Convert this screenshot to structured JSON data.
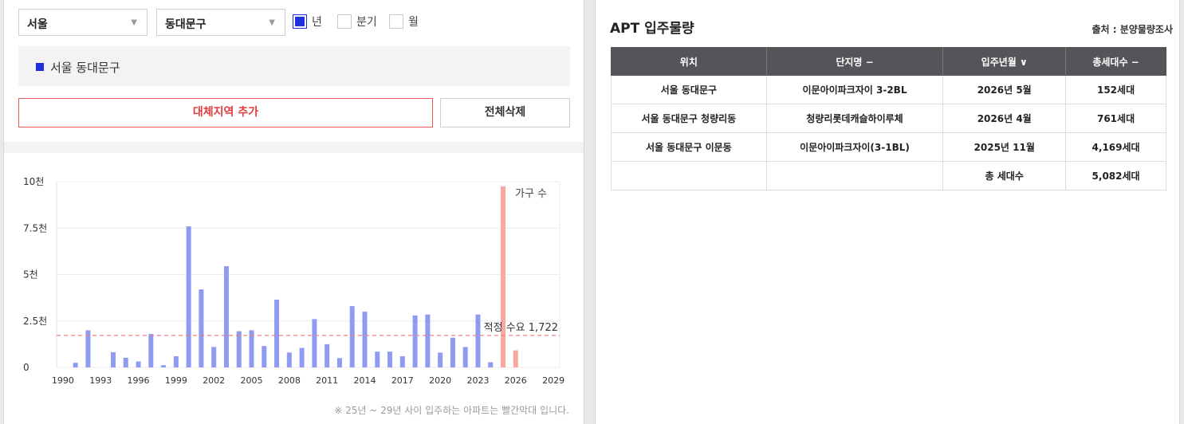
{
  "filters": {
    "sido": "서울",
    "gu": "동대문구",
    "period_options": [
      {
        "label": "년",
        "checked": true
      },
      {
        "label": "분기",
        "checked": false
      },
      {
        "label": "월",
        "checked": false
      }
    ]
  },
  "selected_region": "서울 동대문구",
  "buttons": {
    "add_region": "대체지역 추가",
    "delete_all": "전체삭제"
  },
  "colors": {
    "accent": "#1f2fe0",
    "bar": "#8e9bf0",
    "bar_future": "#f7a8a0",
    "demand_line": "#f08080"
  },
  "chart_data": {
    "type": "bar",
    "x_tick_labels": [
      "1990",
      "1993",
      "1996",
      "1999",
      "2002",
      "2005",
      "2008",
      "2011",
      "2014",
      "2017",
      "2020",
      "2023",
      "2026",
      "2029"
    ],
    "y_tick_labels": [
      "0",
      "2.5천",
      "5천",
      "7.5천",
      "10천"
    ],
    "ylim": [
      0,
      10000
    ],
    "xlim": [
      1989.5,
      2029.5
    ],
    "series": [
      {
        "name": "",
        "color": "#8e9bf0",
        "x": [
          1991,
          1992,
          1993,
          1994,
          1995,
          1996,
          1997,
          1998,
          1999,
          2000,
          2001,
          2002,
          2003,
          2004,
          2005,
          2006,
          2007,
          2008,
          2009,
          2010,
          2011,
          2012,
          2013,
          2014,
          2015,
          2016,
          2017,
          2018,
          2019,
          2020,
          2021,
          2022,
          2023,
          2024
        ],
        "values": [
          250,
          2000,
          0,
          820,
          520,
          320,
          1800,
          120,
          600,
          7600,
          4200,
          1100,
          5450,
          1950,
          2000,
          1150,
          3650,
          800,
          1050,
          2600,
          1250,
          500,
          3300,
          3000,
          850,
          850,
          600,
          2800,
          2850,
          800,
          1600,
          1100,
          2850,
          280
        ]
      },
      {
        "name": "가구 수",
        "color": "#f7a8a0",
        "x": [
          2025,
          2026
        ],
        "values": [
          9750,
          920
        ]
      }
    ],
    "reference_line": {
      "label": "적정 수요 1,722",
      "value": 1722
    },
    "note": "※ 25년 ~ 29년 사이 입주하는 아파트는 빨간막대 입니다."
  },
  "apt": {
    "title": "APT 입주물량",
    "source": "출처 : 분양물량조사",
    "headers": [
      "위치",
      "단지명 −",
      "입주년월 ∨",
      "총세대수 −"
    ],
    "rows": [
      [
        "서울 동대문구",
        "이문아이파크자이 3-2BL",
        "2026년 5월",
        "152세대"
      ],
      [
        "서울 동대문구 청량리동",
        "청량리롯데캐슬하이루체",
        "2026년 4월",
        "761세대"
      ],
      [
        "서울 동대문구 이문동",
        "이문아이파크자이(3-1BL)",
        "2025년 11월",
        "4,169세대"
      ],
      [
        "",
        "",
        "총 세대수",
        "5,082세대"
      ]
    ]
  }
}
